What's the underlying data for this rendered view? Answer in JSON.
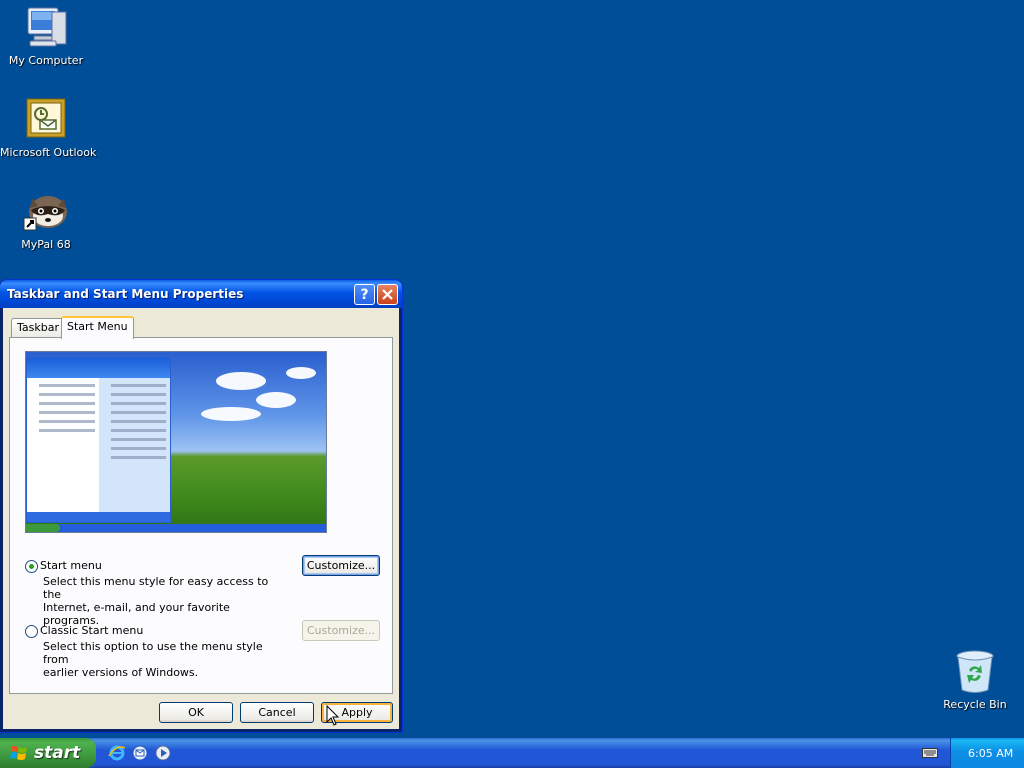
{
  "desktop": {
    "icons": [
      {
        "label": "My Computer",
        "icon": "computer-icon"
      },
      {
        "label": "Microsoft Outlook",
        "icon": "outlook-icon"
      },
      {
        "label": "MyPal 68",
        "icon": "mypal-raccoon-icon"
      },
      {
        "label": "Recycle Bin",
        "icon": "recycle-bin-icon"
      }
    ]
  },
  "dialog": {
    "title": "Taskbar and Start Menu Properties",
    "help_icon": "?",
    "close_icon": "close-icon",
    "tabs": [
      {
        "label": "Taskbar",
        "active": false
      },
      {
        "label": "Start Menu",
        "active": true
      }
    ],
    "options": [
      {
        "label": "Start menu",
        "checked": true,
        "description_line1": "Select this menu style for easy access to the",
        "description_line2": "Internet, e-mail, and your favorite programs.",
        "button": "Customize...",
        "button_enabled": true
      },
      {
        "label": "Classic Start menu",
        "checked": false,
        "description_line1": "Select this option to use the menu style from",
        "description_line2": "earlier versions of Windows.",
        "button": "Customize...",
        "button_enabled": false
      }
    ],
    "buttons": {
      "ok": "OK",
      "cancel": "Cancel",
      "apply": "Apply"
    }
  },
  "taskbar": {
    "start_label": "start",
    "quick_launch": [
      "internet-explorer-icon",
      "outlook-express-icon",
      "media-player-icon"
    ],
    "tray_icons": [
      "keyboard-icon"
    ],
    "clock": "6:05 AM"
  },
  "colors": {
    "desktop": "#004e98",
    "titlebar": "#0055e5",
    "dialog_face": "#ece9d8",
    "start_green": "#3c9a3c",
    "tray_blue": "#0c88e1"
  }
}
